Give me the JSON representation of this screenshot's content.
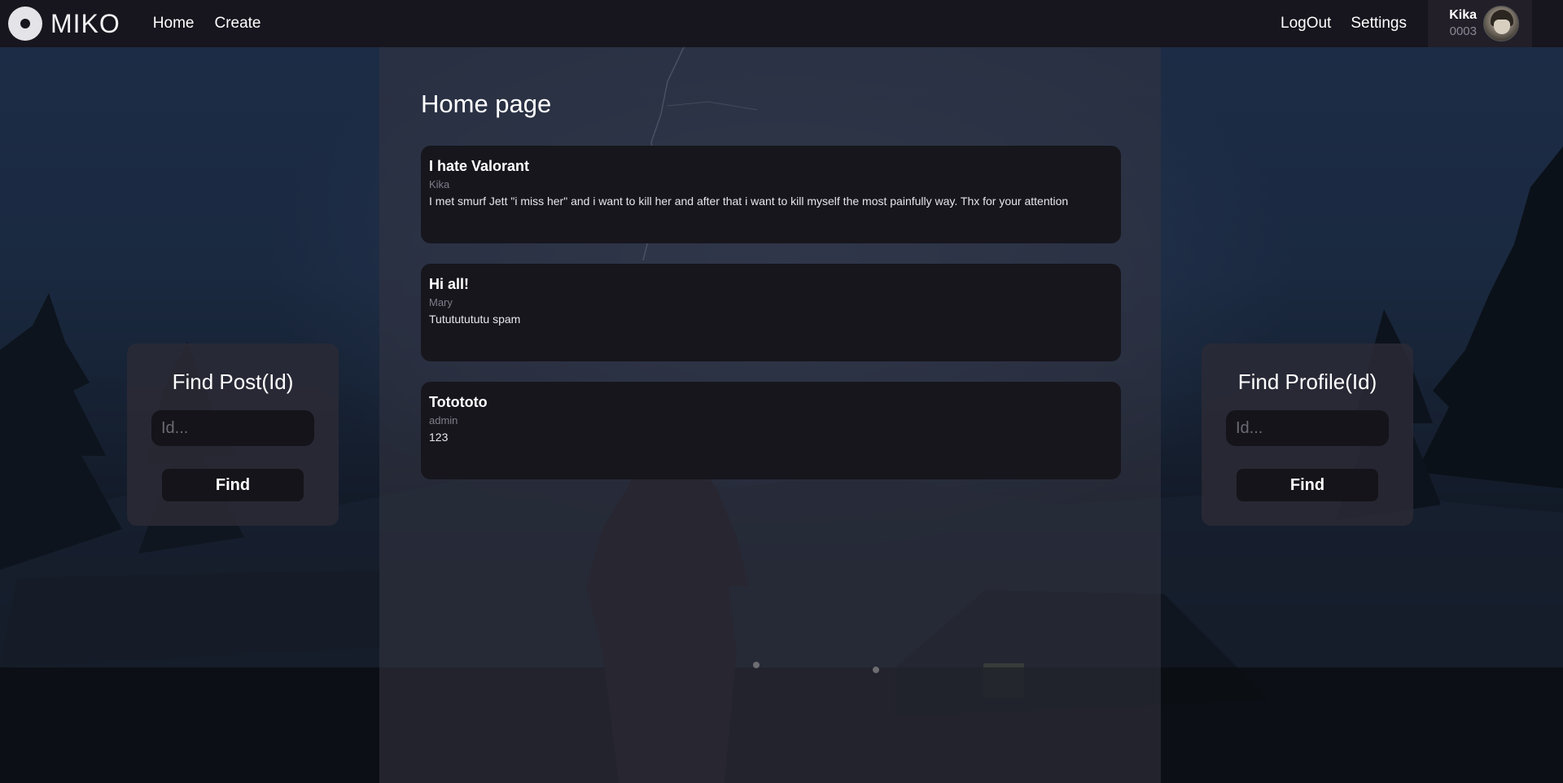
{
  "navbar": {
    "logo_text": "MIKO",
    "links": {
      "home": "Home",
      "create": "Create",
      "logout": "LogOut",
      "settings": "Settings"
    },
    "user": {
      "name": "Kika",
      "id": "0003"
    }
  },
  "main": {
    "title": "Home page",
    "posts": [
      {
        "title": "I hate Valorant",
        "author": "Kika",
        "text": "I met smurf Jett \"i miss her\" and i want to kill her and after that i want to kill myself the most painfully way. Thx for your attention"
      },
      {
        "title": "Hi all!",
        "author": "Mary",
        "text": "Tutututututu spam"
      },
      {
        "title": "Totototo",
        "author": "admin",
        "text": "123"
      }
    ]
  },
  "find_post": {
    "title": "Find Post(Id)",
    "placeholder": "Id...",
    "button": "Find"
  },
  "find_profile": {
    "title": "Find Profile(Id)",
    "placeholder": "Id...",
    "button": "Find"
  },
  "colors": {
    "navbar": "#17151d",
    "card": "#17161d",
    "panel": "#2c2a36",
    "text": "#ffffff",
    "muted": "#7f7d88"
  }
}
